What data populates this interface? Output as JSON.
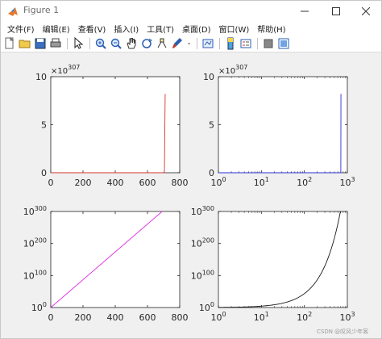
{
  "window": {
    "title": "Figure 1"
  },
  "menu": [
    "文件(F)",
    "编辑(E)",
    "查看(V)",
    "插入(I)",
    "工具(T)",
    "桌面(D)",
    "窗口(W)",
    "帮助(H)"
  ],
  "toolbar": [
    "new-figure-icon",
    "open-file-icon",
    "save-icon",
    "print-icon",
    "|",
    "select-arrow-icon",
    "|",
    "zoom-in-icon",
    "zoom-out-icon",
    "pan-icon",
    "rotate-3d-icon",
    "data-cursor-icon",
    "brush-icon",
    "dropdown-arrow-icon",
    "|",
    "link-plot-icon",
    "|",
    "colorbar-icon",
    "legend-icon",
    "|",
    "hide-plot-tools-icon",
    "show-plot-tools-icon"
  ],
  "axes_common": {
    "exponent_label": "×10",
    "exponent_sup": "307"
  },
  "chart_data": [
    {
      "type": "line",
      "position": "top-left",
      "xscale": "linear",
      "yscale": "linear",
      "xlim": [
        0,
        800
      ],
      "ylim": [
        0,
        10
      ],
      "xticks": [
        "0",
        "200",
        "400",
        "600",
        "800"
      ],
      "yticks": [
        "0",
        "5",
        "10"
      ],
      "y_multiplier": "×10^307",
      "color": "#d9342b",
      "series": [
        {
          "x": [
            0,
            680,
            700,
            705,
            709.78
          ],
          "y": [
            0,
            0,
            0,
            0.15,
            8.2
          ]
        }
      ]
    },
    {
      "type": "line",
      "position": "top-right",
      "xscale": "log",
      "yscale": "linear",
      "xlim": [
        1,
        1000
      ],
      "ylim": [
        0,
        10
      ],
      "xticks": [
        "10^0",
        "10^1",
        "10^2",
        "10^3"
      ],
      "yticks": [
        "0",
        "5",
        "10"
      ],
      "y_multiplier": "×10^307",
      "color": "#2b2bd9",
      "series": [
        {
          "x": [
            1,
            680,
            700,
            705,
            709.78
          ],
          "y": [
            0,
            0,
            0,
            0.15,
            8.2
          ]
        }
      ]
    },
    {
      "type": "line",
      "position": "bottom-left",
      "xscale": "linear",
      "yscale": "log",
      "xlim": [
        0,
        800
      ],
      "ylim_exp": [
        0,
        300
      ],
      "xticks": [
        "0",
        "200",
        "400",
        "600",
        "800"
      ],
      "yticks": [
        "10^0",
        "10^100",
        "10^200",
        "10^300"
      ],
      "color": "#e033e0",
      "series": [
        {
          "x": [
            0,
            709.78
          ],
          "log10y": [
            0,
            308.25
          ]
        }
      ]
    },
    {
      "type": "line",
      "position": "bottom-right",
      "xscale": "log",
      "yscale": "log",
      "xlim": [
        1,
        1000
      ],
      "ylim_exp": [
        0,
        300
      ],
      "xticks": [
        "10^0",
        "10^1",
        "10^2",
        "10^3"
      ],
      "yticks": [
        "10^0",
        "10^100",
        "10^200",
        "10^300"
      ],
      "color": "#1a1a1a",
      "series": [
        {
          "x_from": 1,
          "x_to": 709.78,
          "log10y_is_x_times": 0.4343
        }
      ]
    }
  ],
  "watermark": "CSDN @叹风少年客"
}
